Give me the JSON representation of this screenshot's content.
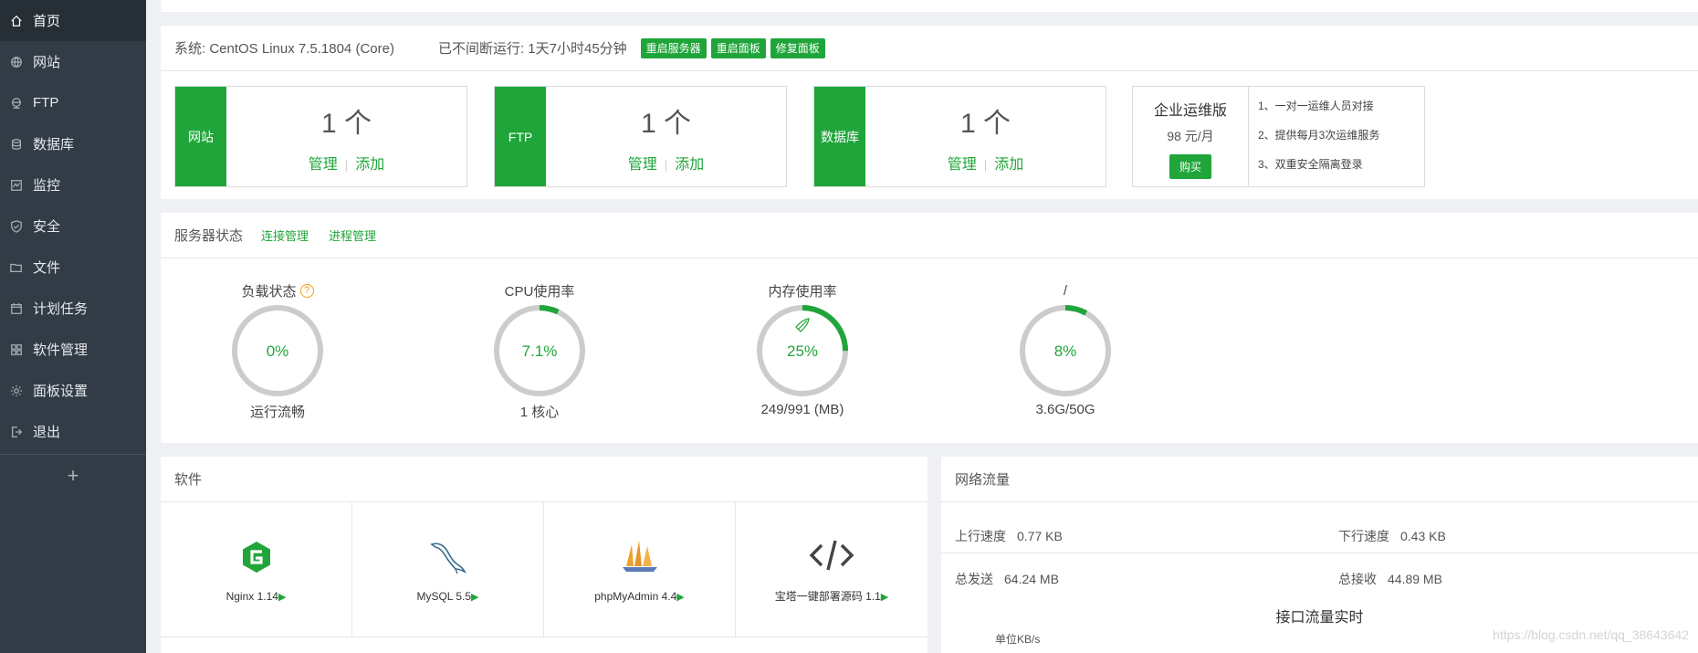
{
  "sidebar": {
    "items": [
      {
        "label": "首页",
        "icon": "home-icon",
        "active": true
      },
      {
        "label": "网站",
        "icon": "globe-icon"
      },
      {
        "label": "FTP",
        "icon": "ftp-icon"
      },
      {
        "label": "数据库",
        "icon": "database-icon"
      },
      {
        "label": "监控",
        "icon": "monitor-icon"
      },
      {
        "label": "安全",
        "icon": "shield-icon"
      },
      {
        "label": "文件",
        "icon": "folder-icon"
      },
      {
        "label": "计划任务",
        "icon": "calendar-icon"
      },
      {
        "label": "软件管理",
        "icon": "grid-icon"
      },
      {
        "label": "面板设置",
        "icon": "gear-icon"
      },
      {
        "label": "退出",
        "icon": "logout-icon"
      }
    ],
    "add_label": "+"
  },
  "system": {
    "os": "系统: CentOS Linux 7.5.1804 (Core)",
    "uptime": "已不间断运行: 1天7小时45分钟",
    "buttons": [
      "重启服务器",
      "重启面板",
      "修复面板"
    ]
  },
  "cards": [
    {
      "tag": "网站",
      "count": "1 个",
      "manage": "管理",
      "add": "添加"
    },
    {
      "tag": "FTP",
      "count": "1 个",
      "manage": "管理",
      "add": "添加"
    },
    {
      "tag": "数据库",
      "count": "1 个",
      "manage": "管理",
      "add": "添加"
    }
  ],
  "enterprise": {
    "title": "企业运维版",
    "price": "98 元/月",
    "buy": "购买",
    "features": [
      "1、一对一运维人员对接",
      "2、提供每月3次运维服务",
      "3、双重安全隔离登录"
    ]
  },
  "status": {
    "title": "服务器状态",
    "links": [
      "连接管理",
      "进程管理"
    ],
    "gauges": [
      {
        "title": "负载状态",
        "value_text": "0%",
        "percent": 0,
        "sub": "运行流畅",
        "help": "?"
      },
      {
        "title": "CPU使用率",
        "value_text": "7.1%",
        "percent": 7.1,
        "sub": "1 核心"
      },
      {
        "title": "内存使用率",
        "value_text": "25%",
        "percent": 25,
        "sub": "249/991 (MB)",
        "rocket": true
      },
      {
        "title": "/",
        "value_text": "8%",
        "percent": 8,
        "sub": "3.6G/50G"
      }
    ]
  },
  "software": {
    "title": "软件",
    "items": [
      {
        "name": "Nginx 1.14",
        "icon": "nginx-icon"
      },
      {
        "name": "MySQL 5.5",
        "icon": "mysql-dolphin-icon"
      },
      {
        "name": "phpMyAdmin 4.4",
        "icon": "phpmyadmin-sailboat-icon"
      },
      {
        "name": "宝塔一键部署源码 1.1",
        "icon": "code-brackets-icon"
      }
    ],
    "play": "▶"
  },
  "network": {
    "title": "网络流量",
    "up_label": "上行速度",
    "up_value": "0.77 KB",
    "down_label": "下行速度",
    "down_value": "0.43 KB",
    "sent_label": "总发送",
    "sent_value": "64.24 MB",
    "recv_label": "总接收",
    "recv_value": "44.89 MB",
    "chart_title": "接口流量实时",
    "unit": "单位KB/s"
  },
  "watermark": "https://blog.csdn.net/qq_38643642",
  "colors": {
    "accent": "#20a53a",
    "sidebar": "#323c46",
    "gauge_track": "#cccccc"
  }
}
